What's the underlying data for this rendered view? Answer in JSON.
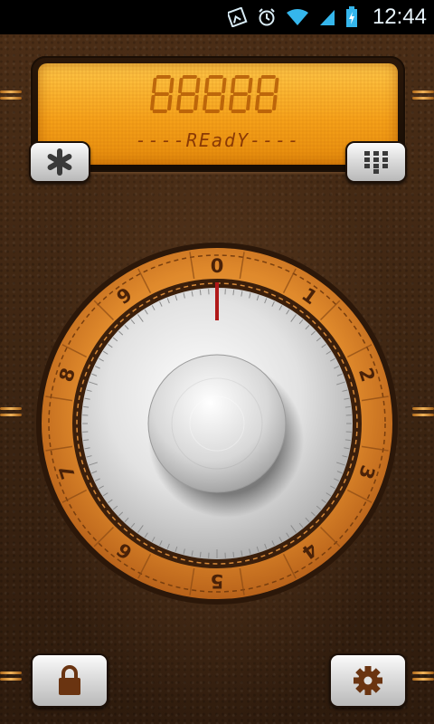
{
  "status_bar": {
    "time": "12:44",
    "icons": [
      "gallery-icon",
      "alarm-icon",
      "wifi-icon",
      "signal-icon",
      "battery-charging-icon"
    ]
  },
  "display": {
    "code_placeholder": "88888",
    "status": "----REadY----"
  },
  "buttons": {
    "star": {
      "icon": "asterisk-icon"
    },
    "keypad": {
      "icon": "keypad-grid-icon"
    },
    "lock": {
      "icon": "padlock-icon"
    },
    "settings": {
      "icon": "gear-icon"
    }
  },
  "dial": {
    "numbers": [
      "0",
      "1",
      "2",
      "3",
      "4",
      "5",
      "6",
      "7",
      "8",
      "9"
    ],
    "indicator_color": "#b01818"
  },
  "colors": {
    "lcd": "#f6a21a",
    "lcd_text": "#8a3a05",
    "leather": "#3d2512",
    "dial_ring": "#e69a3a"
  }
}
